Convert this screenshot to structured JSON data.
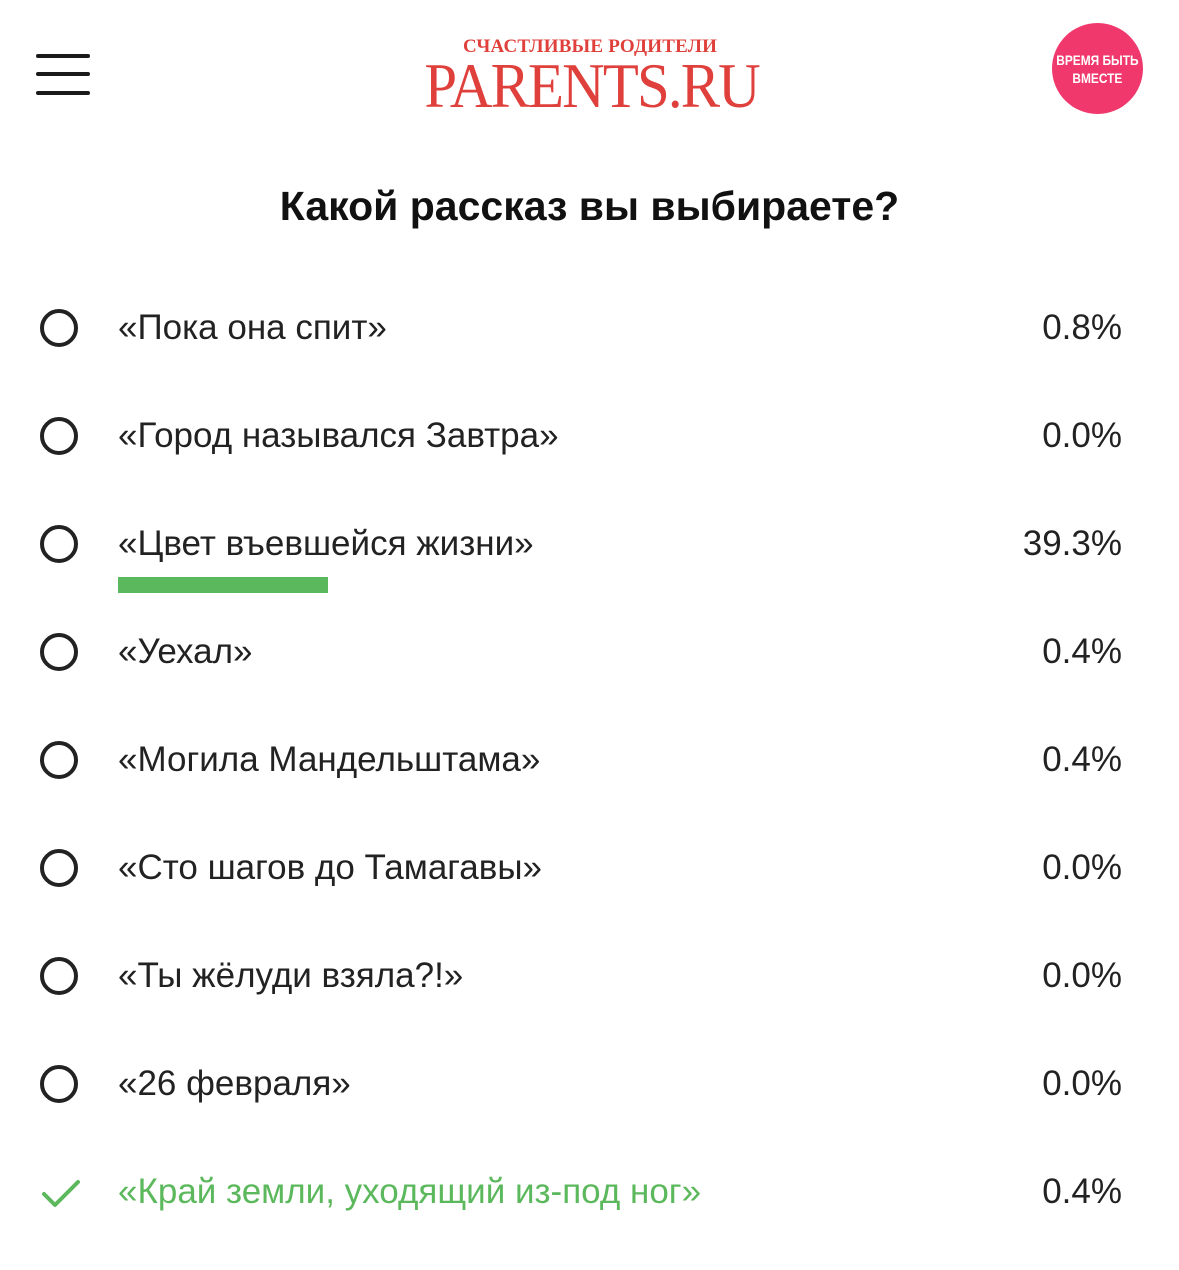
{
  "header": {
    "logo_tagline": "Счастливые родители",
    "logo_main": "PARENTS.RU",
    "promo_line1": "ВРЕМЯ БЫТЬ",
    "promo_line2": "ВМЕСТЕ",
    "menu_icon": "hamburger-menu-icon"
  },
  "colors": {
    "brand": "#e0403c",
    "promo": "#f0386d",
    "accent_green": "#5cb85c",
    "text": "#222222"
  },
  "poll": {
    "title": "Какой рассказ вы выбираете?",
    "options": [
      {
        "label": "«Пока она спит»",
        "percent_text": "0.8%",
        "percent": 0.8,
        "selected": false
      },
      {
        "label": "«Город назывался Завтра»",
        "percent_text": "0.0%",
        "percent": 0.0,
        "selected": false
      },
      {
        "label": "«Цвет въевшейся жизни»",
        "percent_text": "39.3%",
        "percent": 39.3,
        "selected": false
      },
      {
        "label": "«Уехал»",
        "percent_text": "0.4%",
        "percent": 0.4,
        "selected": false
      },
      {
        "label": "«Могила Мандельштама»",
        "percent_text": "0.4%",
        "percent": 0.4,
        "selected": false
      },
      {
        "label": "«Сто шагов до Тамагавы»",
        "percent_text": "0.0%",
        "percent": 0.0,
        "selected": false
      },
      {
        "label": "«Ты жёлуди взяла?!»",
        "percent_text": "0.0%",
        "percent": 0.0,
        "selected": false
      },
      {
        "label": "«26 февраля»",
        "percent_text": "0.0%",
        "percent": 0.0,
        "selected": false
      },
      {
        "label": "«Край земли, уходящий из-под ног»",
        "percent_text": "0.4%",
        "percent": 0.4,
        "selected": true
      }
    ]
  }
}
